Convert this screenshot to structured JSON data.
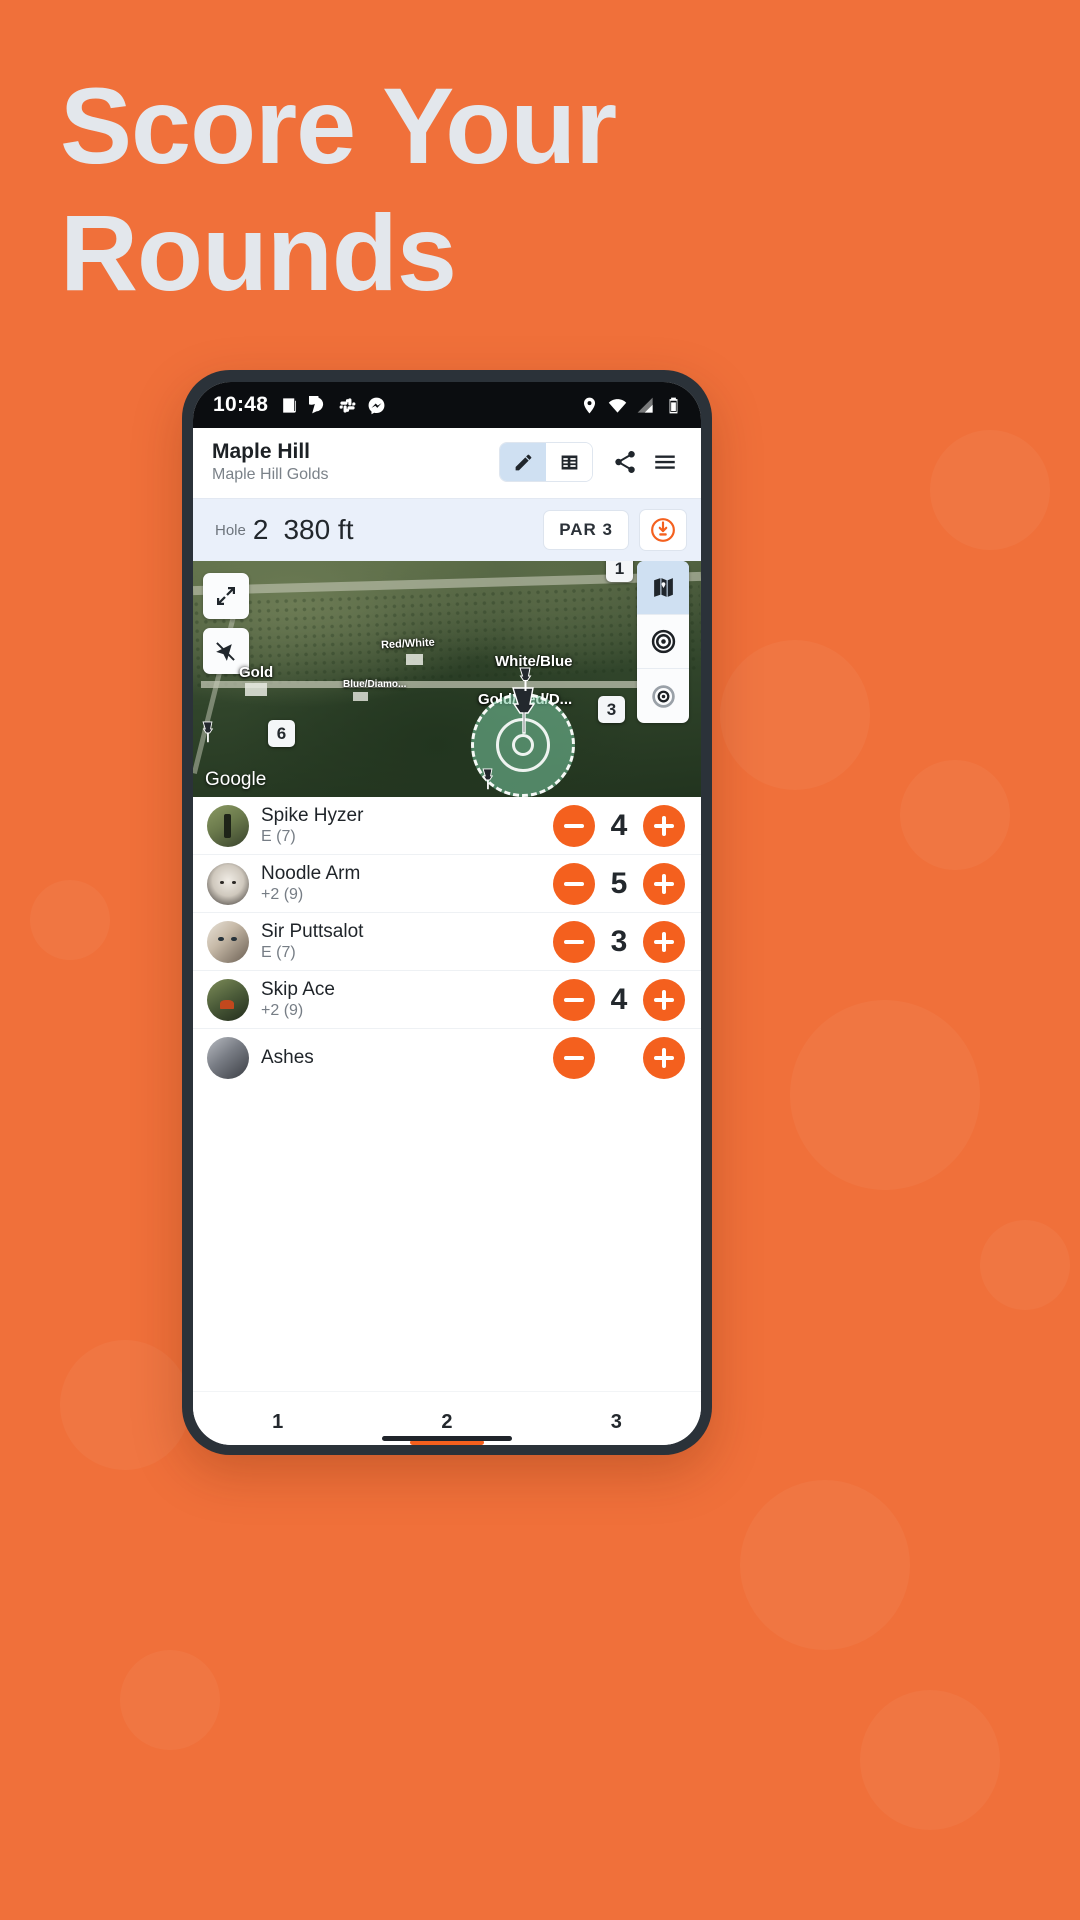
{
  "promo": {
    "headline_line1": "Score Your",
    "headline_line2": "Rounds",
    "background_color": "#f0703a",
    "headline_color": "#e3e7ec"
  },
  "statusbar": {
    "time": "10:48",
    "left_icons": [
      "news-icon",
      "chat-bubble-icon",
      "slack-icon",
      "messenger-icon"
    ],
    "right_icons": [
      "location-pin-icon",
      "wifi-icon",
      "cell-signal-icon",
      "battery-icon"
    ]
  },
  "header": {
    "course_name": "Maple Hill",
    "layout_name": "Maple Hill Golds",
    "segment": [
      {
        "icon": "pencil-icon",
        "active": true
      },
      {
        "icon": "list-icon",
        "active": false
      }
    ],
    "share_icon": "share-icon",
    "menu_icon": "hamburger-menu-icon"
  },
  "hole_bar": {
    "hole_label": "Hole",
    "hole_number": "2",
    "distance": "380 ft",
    "par_label": "PAR 3",
    "basket_icon": "disc-basket-icon",
    "accent_color": "#f4601e"
  },
  "map": {
    "expand_icon": "expand-arrows-icon",
    "navigation_off_icon": "navigation-off-icon",
    "right_controls": [
      {
        "icon": "map-layers-icon",
        "active": true
      },
      {
        "icon": "target-dark-icon",
        "active": false
      },
      {
        "icon": "target-gray-icon",
        "active": false
      }
    ],
    "labels": [
      {
        "text": "White/Blue"
      },
      {
        "text": "Gold/Red/D..."
      },
      {
        "text": "Gold"
      },
      {
        "text": "Red/White"
      },
      {
        "text": "Blue/Diamo..."
      }
    ],
    "hole_markers": [
      "6",
      "3"
    ],
    "attribution": "Google"
  },
  "players": [
    {
      "name": "Spike Hyzer",
      "relative": "E (7)",
      "score": "4",
      "avatar_color1": "#7d8b5a",
      "avatar_color2": "#43503a"
    },
    {
      "name": "Noodle Arm",
      "relative": "+2 (9)",
      "score": "5",
      "avatar_color1": "#d9d4cb",
      "avatar_color2": "#56514c"
    },
    {
      "name": "Sir Puttsalot",
      "relative": "E (7)",
      "score": "3",
      "avatar_color1": "#cfc3b4",
      "avatar_color2": "#5f554c"
    },
    {
      "name": "Skip Ace",
      "relative": "+2 (9)",
      "score": "4",
      "avatar_color1": "#6f7c4f",
      "avatar_color2": "#3b4630"
    },
    {
      "name": "Ashes",
      "relative": "",
      "score": "",
      "avatar_color1": "#8d9097",
      "avatar_color2": "#4a4d53"
    }
  ],
  "controls": {
    "minus_icon": "minus-icon",
    "plus_icon": "plus-icon"
  },
  "bottom_nav": {
    "tabs": [
      {
        "label": "1",
        "active": false
      },
      {
        "label": "2",
        "active": true
      },
      {
        "label": "3",
        "active": false
      }
    ]
  }
}
